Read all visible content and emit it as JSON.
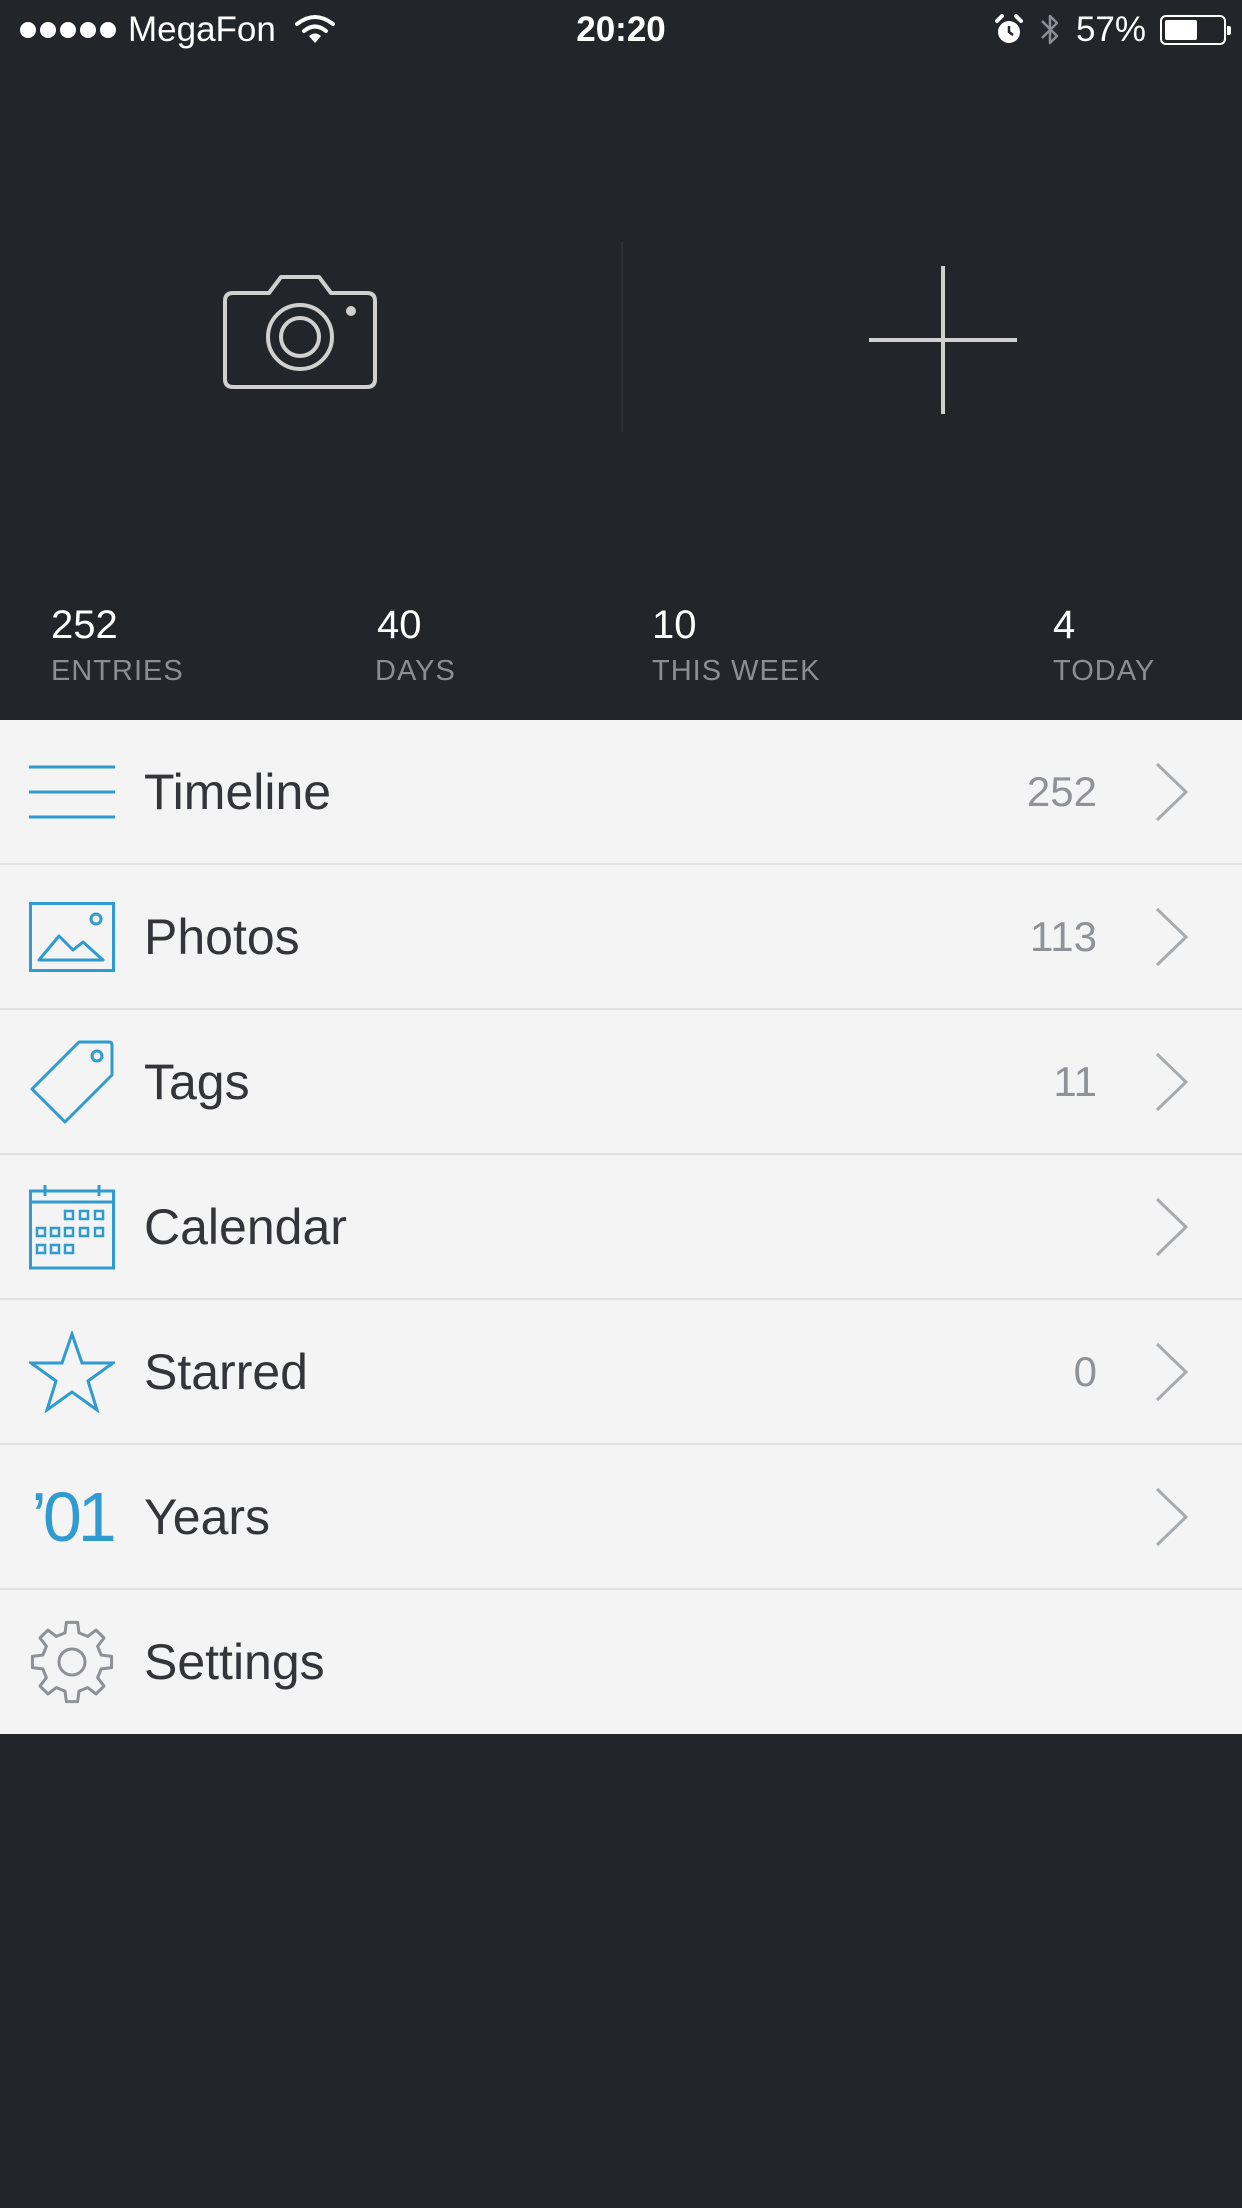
{
  "status_bar": {
    "carrier": "MegaFon",
    "time": "20:20",
    "battery_percent": "57%",
    "battery_level": 0.57,
    "icons": [
      "signal-dots-icon",
      "wifi-icon",
      "alarm-icon",
      "bluetooth-icon",
      "battery-icon"
    ]
  },
  "actions": {
    "camera_icon": "camera-icon",
    "new_entry_icon": "plus-icon"
  },
  "stats": [
    {
      "value": "252",
      "label": "ENTRIES"
    },
    {
      "value": "40",
      "label": "DAYS"
    },
    {
      "value": "10",
      "label": "THIS WEEK"
    },
    {
      "value": "4",
      "label": "TODAY"
    }
  ],
  "menu": [
    {
      "label": "Timeline",
      "count": "252",
      "icon": "timeline-icon",
      "chevron": true
    },
    {
      "label": "Photos",
      "count": "113",
      "icon": "photos-icon",
      "chevron": true
    },
    {
      "label": "Tags",
      "count": "11",
      "icon": "tag-icon",
      "chevron": true
    },
    {
      "label": "Calendar",
      "count": "",
      "icon": "calendar-icon",
      "chevron": true
    },
    {
      "label": "Starred",
      "count": "0",
      "icon": "star-icon",
      "chevron": true
    },
    {
      "label": "Years",
      "count": "",
      "icon": "years-icon",
      "icon_text": "’01",
      "chevron": true
    },
    {
      "label": "Settings",
      "count": "",
      "icon": "gear-icon",
      "chevron": false
    }
  ],
  "colors": {
    "background": "#22262b",
    "accent": "#2f9bd0",
    "menu_background": "#f4f4f4"
  }
}
